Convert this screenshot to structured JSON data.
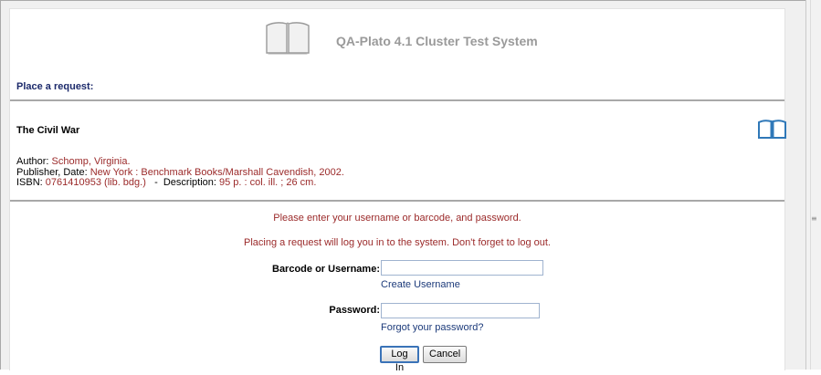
{
  "header": {
    "title": "QA-Plato 4.1 Cluster Test System",
    "logo_icon": "open-book-icon"
  },
  "section": {
    "heading": "Place a request:"
  },
  "item": {
    "title": "The Civil War",
    "icon": "open-book-icon",
    "author_label": "Author:",
    "author_value": "Schomp, Virginia.",
    "publisher_label": "Publisher, Date:",
    "publisher_value": "New York : Benchmark Books/Marshall Cavendish, 2002.",
    "isbn_label": "ISBN:",
    "isbn_value": "0761410953 (lib. bdg.)",
    "separator": "-",
    "description_label": "Description:",
    "description_value": "95 p. : col. ill. ; 26 cm."
  },
  "login": {
    "instruction": "Please enter your username or barcode, and password.",
    "warning": "Placing a request will log you in to the system. Don't forget to log out.",
    "username_label": "Barcode or Username:",
    "username_value": "",
    "create_username_link": "Create Username",
    "password_label": "Password:",
    "password_value": "",
    "forgot_password_link": "Forgot your password?",
    "login_button": "Log In",
    "cancel_button": "Cancel"
  },
  "colors": {
    "heading": "#1c2a6b",
    "value_text": "#9b2a2a",
    "link": "#1c3a7a",
    "title_gray": "#9a9a9a",
    "icon_blue": "#2f78b8"
  }
}
